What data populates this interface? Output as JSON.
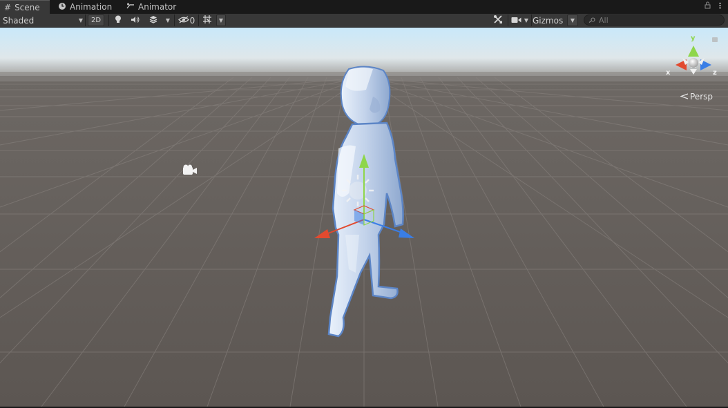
{
  "tabs": [
    {
      "label": "Scene",
      "icon": "grid-icon",
      "active": true
    },
    {
      "label": "Animation",
      "icon": "clock-icon",
      "active": false
    },
    {
      "label": "Animator",
      "icon": "animator-icon",
      "active": false
    }
  ],
  "toolbar": {
    "draw_mode": "Shaded",
    "toggle_2d": "2D",
    "hidden_count": "0",
    "gizmos_label": "Gizmos"
  },
  "search": {
    "placeholder": "All"
  },
  "scene": {
    "projection_label": "Persp",
    "axis_labels": {
      "x": "x",
      "y": "y",
      "z": "z"
    },
    "colors": {
      "sky_top": "#bfe0f6",
      "horizon": "#8d8985",
      "ground": "#5c5652",
      "grid": "#7a746f",
      "axis_x": "#e24a2f",
      "axis_y": "#8ed64a",
      "axis_z": "#3a7ee6",
      "character": "#c8d8f0",
      "character_outline": "#5c85c6"
    }
  }
}
